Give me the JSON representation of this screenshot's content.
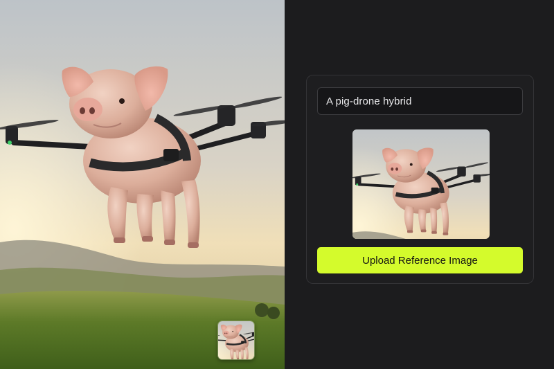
{
  "prompt": {
    "value": "A pig-drone hybrid"
  },
  "upload_button": {
    "label": "Upload Reference Image"
  },
  "colors": {
    "panel_bg": "#1c1c1e",
    "card_border": "#333336",
    "accent": "#d4fb2c",
    "input_text": "#e8e8ea"
  },
  "images": {
    "hero": "pig-drone-over-meadow-photo",
    "thumbnail": "pig-drone-thumbnail",
    "preview": "pig-drone-preview"
  }
}
